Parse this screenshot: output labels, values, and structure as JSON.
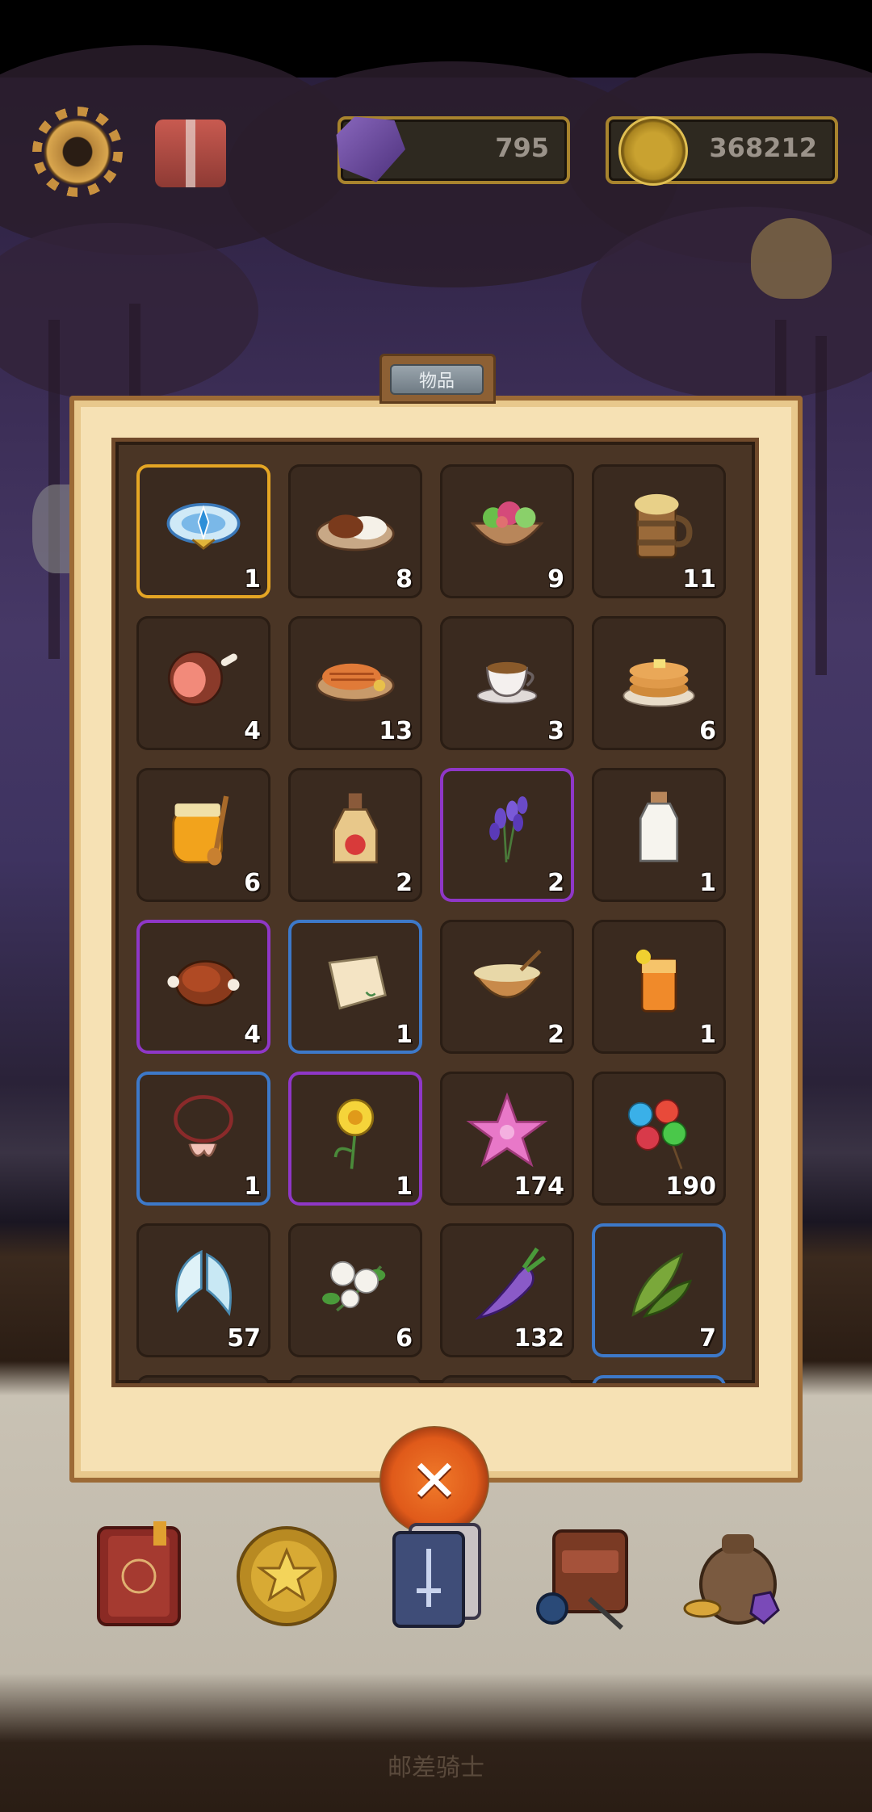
{
  "hud": {
    "gems": "795",
    "coins": "368212"
  },
  "panel": {
    "title": "物品"
  },
  "items": [
    {
      "icon": "winged-crown-icon",
      "count": "1",
      "border": "orange"
    },
    {
      "icon": "curry-rice-icon",
      "count": "8",
      "border": "none"
    },
    {
      "icon": "salad-bowl-icon",
      "count": "9",
      "border": "none"
    },
    {
      "icon": "beer-mug-icon",
      "count": "11",
      "border": "none"
    },
    {
      "icon": "ham-icon",
      "count": "4",
      "border": "none"
    },
    {
      "icon": "grilled-fish-icon",
      "count": "13",
      "border": "none"
    },
    {
      "icon": "tea-cup-icon",
      "count": "3",
      "border": "none"
    },
    {
      "icon": "pancakes-icon",
      "count": "6",
      "border": "none"
    },
    {
      "icon": "honey-jar-icon",
      "count": "6",
      "border": "none"
    },
    {
      "icon": "apple-juice-bottle-icon",
      "count": "2",
      "border": "none"
    },
    {
      "icon": "lavender-icon",
      "count": "2",
      "border": "purple"
    },
    {
      "icon": "milk-bottle-icon",
      "count": "1",
      "border": "none"
    },
    {
      "icon": "roast-meat-icon",
      "count": "4",
      "border": "purple"
    },
    {
      "icon": "cloth-scrap-icon",
      "count": "1",
      "border": "blue"
    },
    {
      "icon": "soup-bowl-icon",
      "count": "2",
      "border": "none"
    },
    {
      "icon": "iced-tea-icon",
      "count": "1",
      "border": "none"
    },
    {
      "icon": "shell-necklace-icon",
      "count": "1",
      "border": "blue"
    },
    {
      "icon": "daffodil-icon",
      "count": "1",
      "border": "purple"
    },
    {
      "icon": "pink-starflower-icon",
      "count": "174",
      "border": "none"
    },
    {
      "icon": "berry-cluster-icon",
      "count": "190",
      "border": "none"
    },
    {
      "icon": "white-wings-icon",
      "count": "57",
      "border": "none"
    },
    {
      "icon": "cotton-flower-icon",
      "count": "6",
      "border": "none"
    },
    {
      "icon": "purple-radish-icon",
      "count": "132",
      "border": "none"
    },
    {
      "icon": "bay-leaves-icon",
      "count": "7",
      "border": "blue"
    }
  ],
  "colors": {
    "border_orange": "#e5a624",
    "border_purple": "#8f37c7",
    "border_blue": "#3d79c9"
  },
  "bottom_nav": [
    {
      "icon": "journal-book-icon"
    },
    {
      "icon": "star-coin-icon"
    },
    {
      "icon": "sword-cards-icon"
    },
    {
      "icon": "backpack-potion-icon"
    },
    {
      "icon": "treasure-sack-icon"
    }
  ],
  "footer": {
    "text": "邮差骑士"
  }
}
